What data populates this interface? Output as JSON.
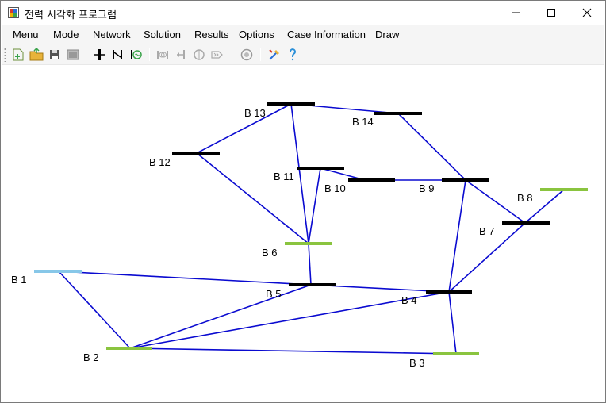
{
  "window": {
    "title": "전력 시각화 프로그램",
    "minimize_icon": "minimize-icon",
    "maximize_icon": "maximize-icon",
    "close_icon": "close-icon"
  },
  "menu": {
    "items": [
      "Menu",
      "Mode",
      "Network",
      "Solution",
      "Results",
      "Options",
      "Case Information",
      "Draw"
    ]
  },
  "toolbar": {
    "groups": [
      [
        "new-file-icon",
        "open-folder-icon",
        "save-icon",
        "image-icon"
      ],
      [
        "bus-icon",
        "line-icon",
        "generator-icon"
      ],
      [
        "transformer-icon",
        "load-icon",
        "shunt-icon",
        "switch-icon"
      ],
      [
        "settings-icon"
      ],
      [
        "tools-icon",
        "help-icon"
      ]
    ]
  },
  "colors": {
    "line": "#0a0ad0",
    "bus_normal": "#000000",
    "bus_generator": "#8ac43f",
    "bus_slack": "#87c7e8"
  },
  "network": {
    "buses": [
      {
        "id": "B1",
        "label": "B 1",
        "type": "slack"
      },
      {
        "id": "B2",
        "label": "B 2",
        "type": "generator"
      },
      {
        "id": "B3",
        "label": "B 3",
        "type": "generator"
      },
      {
        "id": "B4",
        "label": "B 4",
        "type": "normal"
      },
      {
        "id": "B5",
        "label": "B 5",
        "type": "normal"
      },
      {
        "id": "B6",
        "label": "B 6",
        "type": "generator"
      },
      {
        "id": "B7",
        "label": "B 7",
        "type": "normal"
      },
      {
        "id": "B8",
        "label": "B 8",
        "type": "generator"
      },
      {
        "id": "B9",
        "label": "B 9",
        "type": "normal"
      },
      {
        "id": "B10",
        "label": "B 10",
        "type": "normal"
      },
      {
        "id": "B11",
        "label": "B 11",
        "type": "normal"
      },
      {
        "id": "B12",
        "label": "B 12",
        "type": "normal"
      },
      {
        "id": "B13",
        "label": "B 13",
        "type": "normal"
      },
      {
        "id": "B14",
        "label": "B 14",
        "type": "normal"
      }
    ],
    "branches": [
      [
        "B1",
        "B2"
      ],
      [
        "B1",
        "B5"
      ],
      [
        "B2",
        "B3"
      ],
      [
        "B2",
        "B4"
      ],
      [
        "B2",
        "B5"
      ],
      [
        "B3",
        "B4"
      ],
      [
        "B4",
        "B5"
      ],
      [
        "B4",
        "B7"
      ],
      [
        "B4",
        "B9"
      ],
      [
        "B5",
        "B6"
      ],
      [
        "B6",
        "B11"
      ],
      [
        "B6",
        "B12"
      ],
      [
        "B6",
        "B13"
      ],
      [
        "B7",
        "B8"
      ],
      [
        "B7",
        "B9"
      ],
      [
        "B9",
        "B10"
      ],
      [
        "B9",
        "B14"
      ],
      [
        "B10",
        "B11"
      ],
      [
        "B12",
        "B13"
      ],
      [
        "B13",
        "B14"
      ]
    ]
  }
}
